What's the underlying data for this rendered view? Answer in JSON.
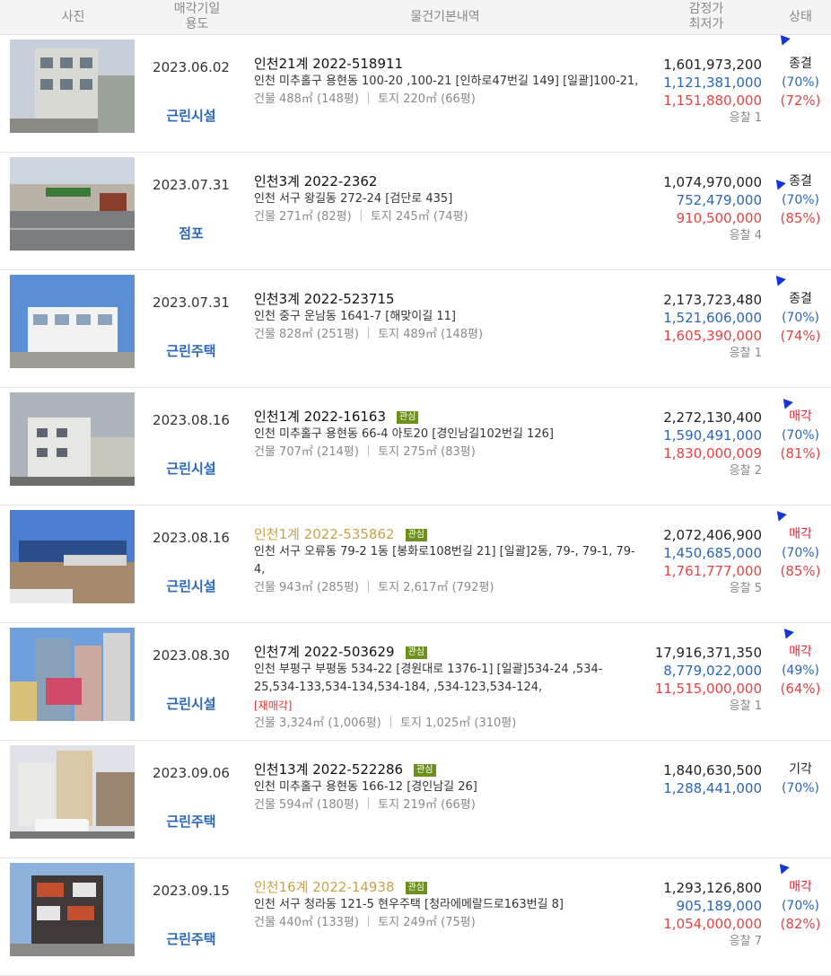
{
  "header": {
    "photo": "사진",
    "date_line1": "매각기일",
    "date_line2": "용도",
    "info": "물건기본내역",
    "price_line1": "감정가",
    "price_line2": "최저가",
    "status": "상태"
  },
  "colors": {
    "blue": "#2a66b5",
    "red": "#e24444",
    "badge": "#6d8f1c",
    "gold": "#c8a24a"
  },
  "rows": [
    {
      "date": "2023.06.02",
      "use": "근린시설",
      "case": "인천21계 2022-518911",
      "badge": "",
      "address": "인천 미추홀구 용현동 100-20 ,100-21 [인하로47번길 149] [일괄]100-21,",
      "retag": "",
      "area": "건물 488㎡ (148평)  ｜ 토지 220㎡ (66평)",
      "appraisal": "1,601,973,200",
      "minimum": "1,121,381,000",
      "sold_price": "1,151,880,000",
      "bids": "응찰 1",
      "status": "종결",
      "min_rate": "(70%)",
      "sold_rate": "(72%)"
    },
    {
      "date": "2023.07.31",
      "use": "점포",
      "case": "인천3계 2022-2362",
      "badge": "",
      "address": "인천 서구 왕길동 272-24 [검단로 435]",
      "retag": "",
      "area": "건물 271㎡ (82평)  ｜ 토지 245㎡ (74평)",
      "appraisal": "1,074,970,000",
      "minimum": "752,479,000",
      "sold_price": "910,500,000",
      "bids": "응찰 4",
      "status": "종결",
      "min_rate": "(70%)",
      "sold_rate": "(85%)"
    },
    {
      "date": "2023.07.31",
      "use": "근린주택",
      "case": "인천3계 2022-523715",
      "badge": "",
      "address": "인천 중구 운남동 1641-7 [해맞이길 11]",
      "retag": "",
      "area": "건물 828㎡ (251평)  ｜ 토지 489㎡ (148평)",
      "appraisal": "2,173,723,480",
      "minimum": "1,521,606,000",
      "sold_price": "1,605,390,000",
      "bids": "응찰 1",
      "status": "종결",
      "min_rate": "(70%)",
      "sold_rate": "(74%)"
    },
    {
      "date": "2023.08.16",
      "use": "근린시설",
      "case": "인천1계 2022-16163",
      "badge": "관심",
      "address": "인천 미추홀구 용현동 66-4 아토20 [경인남길102번길 126]",
      "retag": "",
      "area": "건물 707㎡ (214평)  ｜ 토지 275㎡ (83평)",
      "appraisal": "2,272,130,400",
      "minimum": "1,590,491,000",
      "sold_price": "1,830,000,009",
      "bids": "응찰 2",
      "status": "매각",
      "min_rate": "(70%)",
      "sold_rate": "(81%)"
    },
    {
      "date": "2023.08.16",
      "use": "근린시설",
      "case": "인천1계 2022-535862",
      "badge": "관심",
      "address": "인천 서구 오류동 79-2 1동 [봉화로108번길 21] [일괄]2동, 79-, 79-1, 79-4,",
      "retag": "",
      "area": "건물 943㎡ (285평)  ｜ 토지 2,617㎡ (792평)",
      "appraisal": "2,072,406,900",
      "minimum": "1,450,685,000",
      "sold_price": "1,761,777,000",
      "bids": "응찰 5",
      "status": "매각",
      "min_rate": "(70%)",
      "sold_rate": "(85%)"
    },
    {
      "date": "2023.08.30",
      "use": "근린시설",
      "case": "인천7계 2022-503629",
      "badge": "관심",
      "address": "인천 부평구 부평동 534-22 [경원대로 1376-1] [일괄]534-24 ,534-25,534-133,534-134,534-184, ,534-123,534-124,",
      "retag": "[재매각]",
      "area": "건물 3,324㎡ (1,006평)  ｜ 토지 1,025㎡ (310평)",
      "appraisal": "17,916,371,350",
      "minimum": "8,779,022,000",
      "sold_price": "11,515,000,000",
      "bids": "응찰 1",
      "status": "매각",
      "min_rate": "(49%)",
      "sold_rate": "(64%)"
    },
    {
      "date": "2023.09.06",
      "use": "근린주택",
      "case": "인천13계 2022-522286",
      "badge": "관심",
      "address": "인천 미추홀구 용현동 166-12 [경인남길 26]",
      "retag": "",
      "area": "건물 594㎡ (180평)  ｜ 토지 219㎡ (66평)",
      "appraisal": "1,840,630,500",
      "minimum": "1,288,441,000",
      "sold_price": "",
      "bids": "",
      "status": "기각",
      "min_rate": "(70%)",
      "sold_rate": ""
    },
    {
      "date": "2023.09.15",
      "use": "근린주택",
      "case": "인천16계 2022-14938",
      "badge": "관심",
      "address": "인천 서구 청라동 121-5 현우주택 [청라에메랄드로163번길 8]",
      "retag": "",
      "area": "건물 440㎡ (133평)  ｜ 토지 249㎡ (75평)",
      "appraisal": "1,293,126,800",
      "minimum": "905,189,000",
      "sold_price": "1,054,000,000",
      "bids": "응찰 7",
      "status": "매각",
      "min_rate": "(70%)",
      "sold_rate": "(82%)"
    }
  ]
}
